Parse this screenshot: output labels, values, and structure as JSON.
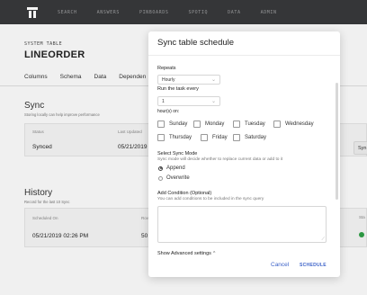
{
  "nav": {
    "items": [
      "SEARCH",
      "ANSWERS",
      "PINBOARDS",
      "SPOTIQ",
      "DATA",
      "ADMIN"
    ]
  },
  "page": {
    "eyebrow": "SYSTEM TABLE",
    "title": "LINEORDER",
    "tabs": [
      "Columns",
      "Schema",
      "Data",
      "Dependen"
    ]
  },
  "sync": {
    "title": "Sync",
    "subtitle": "Storing locally can help improve performance",
    "headers": {
      "status": "Status",
      "last_updated": "Last Updated"
    },
    "status": "Synced",
    "last_updated": "05/21/2019",
    "button_label": "Syn"
  },
  "history": {
    "title": "History",
    "subtitle": "Record for the last 10 Sync",
    "headers": {
      "scheduled_on": "Scheduled On",
      "rows": "Rov",
      "status": "Sta"
    },
    "rows": [
      {
        "scheduled_on": "05/21/2019 02:26 PM",
        "rows": "50"
      }
    ]
  },
  "modal": {
    "title": "Sync table schedule",
    "repeats_label": "Repeats",
    "repeats_value": "Hourly",
    "run_every_label": "Run the task every",
    "run_every_value": "1",
    "hours_label": "hour(s) on:",
    "days": [
      {
        "label": "Sunday",
        "checked": false
      },
      {
        "label": "Monday",
        "checked": false
      },
      {
        "label": "Tuesday",
        "checked": false
      },
      {
        "label": "Wednesday",
        "checked": false
      },
      {
        "label": "Thursday",
        "checked": false
      },
      {
        "label": "Friday",
        "checked": false
      },
      {
        "label": "Saturday",
        "checked": false
      }
    ],
    "sync_mode_label": "Select Sync Mode",
    "sync_mode_help": "Sync mode will decide whether to replace current data or add to it",
    "modes": [
      {
        "label": "Append",
        "selected": true
      },
      {
        "label": "Overwrite",
        "selected": false
      }
    ],
    "condition_label": "Add Condition (Optional)",
    "condition_help": "You can add conditions to be included in the sync query",
    "condition_value": "",
    "advanced_label": "Show Advanced settings",
    "cancel_label": "Cancel",
    "schedule_label": "SCHEDULE"
  },
  "colors": {
    "nav_bg": "#38393b",
    "accent": "#3d63c9",
    "success": "#2e9e45"
  }
}
